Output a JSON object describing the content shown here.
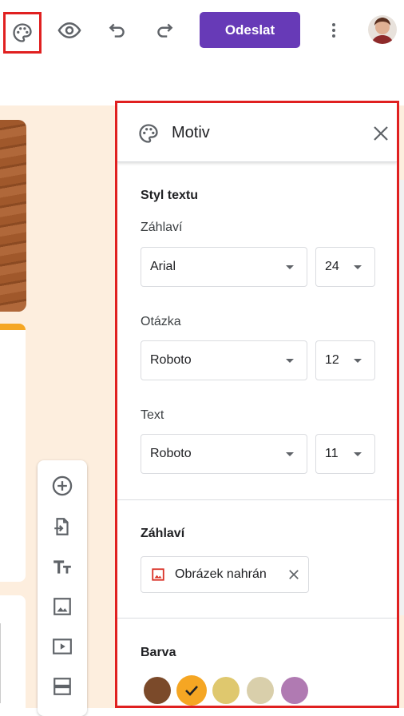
{
  "toolbar": {
    "icons": [
      "palette-icon",
      "eye-icon",
      "undo-icon",
      "redo-icon",
      "more-vert-icon"
    ],
    "send_label": "Odeslat"
  },
  "panel": {
    "title": "Motiv",
    "text_style": {
      "title": "Styl textu",
      "header": {
        "label": "Záhlaví",
        "font": "Arial",
        "size": "24"
      },
      "question": {
        "label": "Otázka",
        "font": "Roboto",
        "size": "12"
      },
      "text": {
        "label": "Text",
        "font": "Roboto",
        "size": "11"
      }
    },
    "header_section": {
      "title": "Záhlaví",
      "chip_label": "Obrázek nahrán"
    },
    "color_section": {
      "title": "Barva",
      "colors": [
        "#7b4a2a",
        "#f5a623",
        "#dfc86e",
        "#d9cfab",
        "#b07ab2"
      ],
      "selected_index": 1
    }
  },
  "colors": {
    "accent": "#673ab7",
    "highlight": "#e02020",
    "canvas": "#fdeede"
  }
}
